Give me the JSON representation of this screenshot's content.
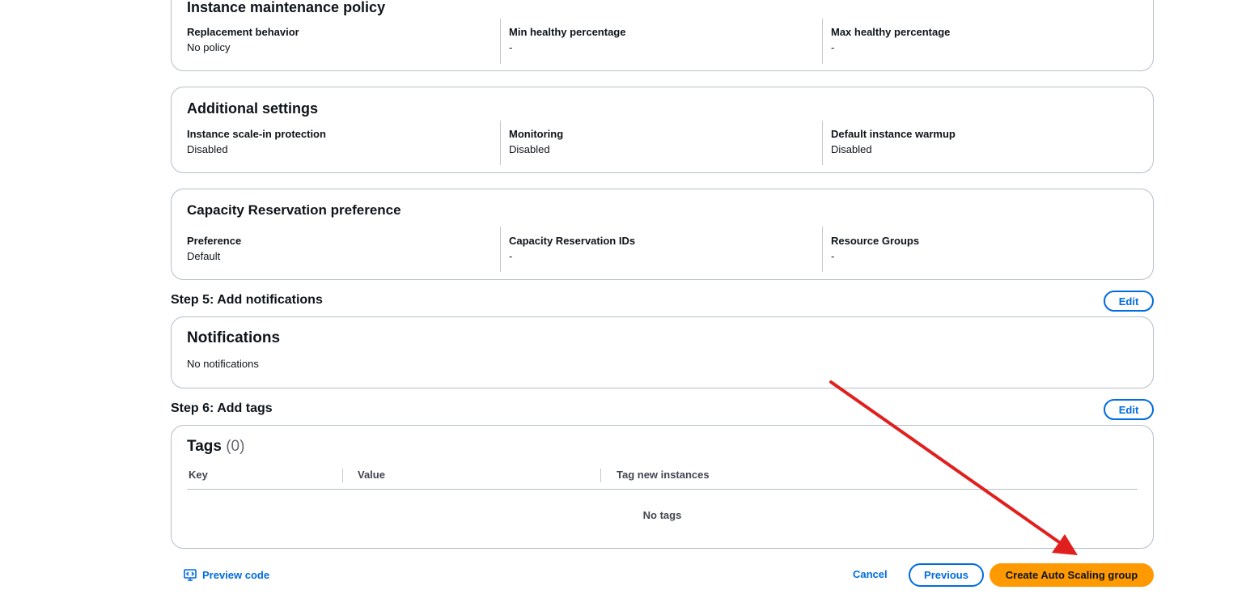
{
  "maintenance": {
    "title": "Instance maintenance policy",
    "fields": [
      {
        "label": "Replacement behavior",
        "value": "No policy"
      },
      {
        "label": "Min healthy percentage",
        "value": "-"
      },
      {
        "label": "Max healthy percentage",
        "value": "-"
      }
    ]
  },
  "additional": {
    "title": "Additional settings",
    "fields": [
      {
        "label": "Instance scale-in protection",
        "value": "Disabled"
      },
      {
        "label": "Monitoring",
        "value": "Disabled"
      },
      {
        "label": "Default instance warmup",
        "value": "Disabled"
      }
    ]
  },
  "capacity": {
    "title": "Capacity Reservation preference",
    "fields": [
      {
        "label": "Preference",
        "value": "Default"
      },
      {
        "label": "Capacity Reservation IDs",
        "value": "-"
      },
      {
        "label": "Resource Groups",
        "value": "-"
      }
    ]
  },
  "step5": {
    "title": "Step 5: Add notifications",
    "edit_label": "Edit",
    "card_title": "Notifications",
    "empty_text": "No notifications"
  },
  "step6": {
    "title": "Step 6: Add tags",
    "edit_label": "Edit",
    "card_title": "Tags",
    "count": "(0)",
    "columns": [
      "Key",
      "Value",
      "Tag new instances"
    ],
    "empty_text": "No tags"
  },
  "footer": {
    "preview_code_label": "Preview code",
    "cancel_label": "Cancel",
    "previous_label": "Previous",
    "create_label": "Create Auto Scaling group"
  },
  "colors": {
    "accent": "#006ce0",
    "primary_button": "#ff9900",
    "annotation_arrow": "#e0201f"
  }
}
